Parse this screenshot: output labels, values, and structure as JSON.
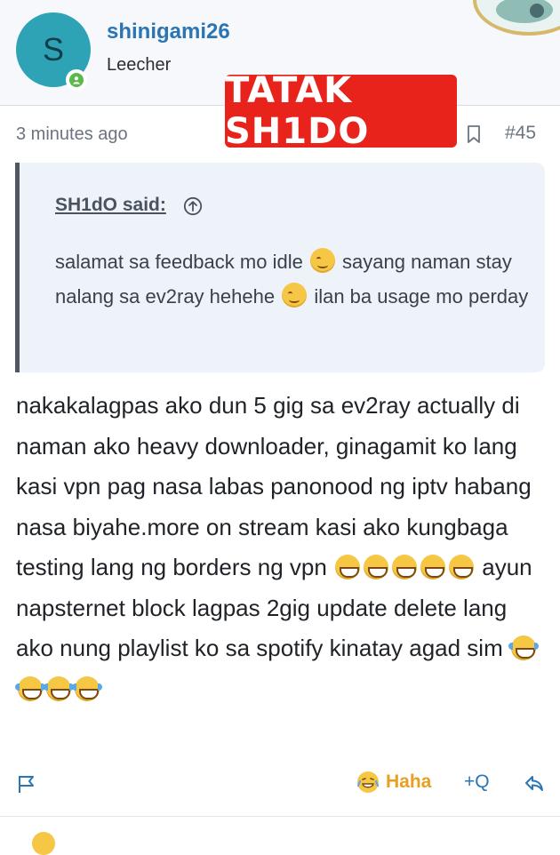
{
  "post": {
    "author": {
      "avatar_letter": "S",
      "username": "shinigami26",
      "title": "Leecher"
    },
    "stamp_text": "TATAK SH1DO",
    "timestamp": "3 minutes ago",
    "post_number": "#45",
    "quote": {
      "author": "SH1dO said:",
      "segments": [
        {
          "text": "salamat sa feedback mo idle "
        },
        {
          "emoji": "smiling-face-with-smiling-eyes"
        },
        {
          "text": " sayang naman stay nalang sa ev2ray hehehe "
        },
        {
          "emoji": "smiling-face-with-smiling-eyes"
        },
        {
          "text": " ilan ba usage mo perday"
        }
      ]
    },
    "body": {
      "segments": [
        {
          "text": "nakakalagpas ako dun 5 gig sa ev2ray actually di naman ako heavy downloader, ginagamit ko lang kasi vpn pag nasa labas panonood ng iptv habang nasa biyahe.more on stream kasi ako kungbaga testing lang ng borders ng vpn "
        },
        {
          "emoji": "grinning-face-with-smiling-eyes"
        },
        {
          "emoji": "grinning-face-with-smiling-eyes"
        },
        {
          "emoji": "grinning-face-with-smiling-eyes"
        },
        {
          "emoji": "grinning-face-with-smiling-eyes"
        },
        {
          "emoji": "grinning-face-with-smiling-eyes"
        },
        {
          "text": " ayun napsternet block lagpas 2gig update delete lang ako nung playlist ko sa spotify kinatay agad sim "
        },
        {
          "emoji": "face-with-tears-of-joy"
        },
        {
          "emoji": "face-with-tears-of-joy"
        },
        {
          "emoji": "face-with-tears-of-joy"
        },
        {
          "emoji": "face-with-tears-of-joy"
        }
      ]
    },
    "footer": {
      "reaction_label": "Haha",
      "quote_label": "+Q"
    }
  },
  "colors": {
    "username": "#2a76b4",
    "avatar": "#2ea3b6",
    "online": "#5db84c",
    "stamp": "#e8231c",
    "reaction": "#e8a020",
    "quote_bg": "#eef3fa"
  },
  "icons": [
    "online-status-icon",
    "bookmark-icon",
    "quote-jump-arrow-icon",
    "report-flag-icon",
    "haha-reaction-icon",
    "reply-icon"
  ]
}
